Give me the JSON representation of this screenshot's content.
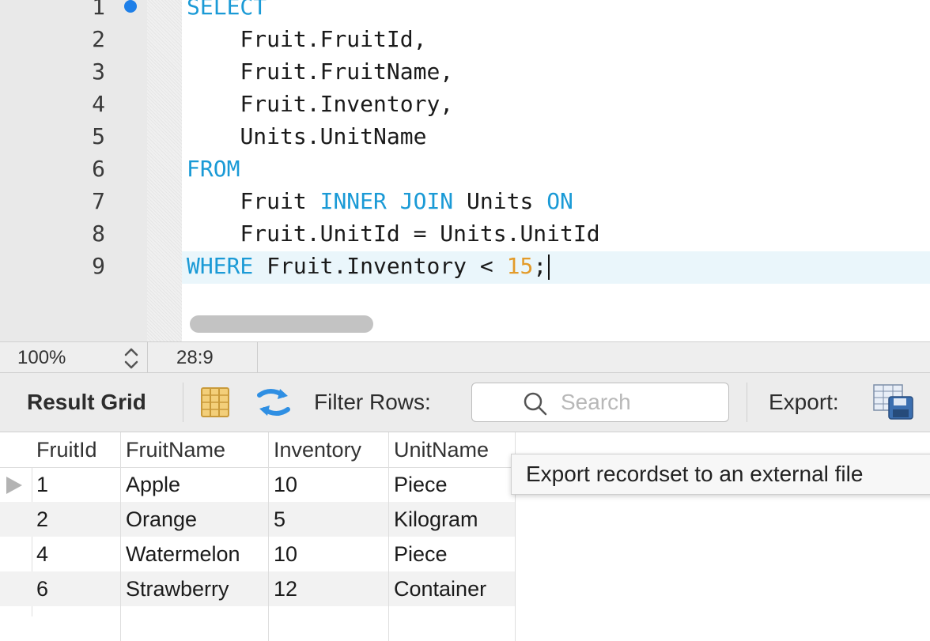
{
  "editor": {
    "line_numbers": [
      "1",
      "2",
      "3",
      "4",
      "5",
      "6",
      "7",
      "8",
      "9"
    ],
    "lines": [
      {
        "kw": "SELECT"
      },
      {
        "indent": "    ",
        "text": "Fruit.FruitId,"
      },
      {
        "indent": "    ",
        "text": "Fruit.FruitName,"
      },
      {
        "indent": "    ",
        "text": "Fruit.Inventory,"
      },
      {
        "indent": "    ",
        "text": "Units.UnitName"
      },
      {
        "kw": "FROM"
      },
      {
        "indent": "    ",
        "t1": "Fruit ",
        "kw1": "INNER JOIN",
        "t2": " Units ",
        "kw2": "ON"
      },
      {
        "indent": "    ",
        "text": "Fruit.UnitId = Units.UnitId"
      },
      {
        "kw": "WHERE",
        "t1": " Fruit.Inventory < ",
        "num": "15",
        "t2": ";"
      }
    ]
  },
  "status": {
    "zoom": "100%",
    "cursor_position": "28:9"
  },
  "toolbar": {
    "result_grid_label": "Result Grid",
    "filter_label": "Filter Rows:",
    "search_placeholder": "Search",
    "export_label": "Export:",
    "export_tooltip": "Export recordset to an external file"
  },
  "grid": {
    "columns": [
      "FruitId",
      "FruitName",
      "Inventory",
      "UnitName"
    ],
    "rows": [
      [
        "1",
        "Apple",
        "10",
        "Piece"
      ],
      [
        "2",
        "Orange",
        "5",
        "Kilogram"
      ],
      [
        "4",
        "Watermelon",
        "10",
        "Piece"
      ],
      [
        "6",
        "Strawberry",
        "12",
        "Container"
      ]
    ]
  },
  "colors": {
    "keyword": "#1a9ad6",
    "number": "#e39b2a",
    "breakpoint": "#1e7fe8"
  },
  "icons": {
    "grid_layout": "grid-layout-icon",
    "refresh": "refresh-icon",
    "search": "search-icon",
    "export": "export-icon",
    "stepper": "zoom-stepper-icon",
    "row_pointer": "current-row-pointer-icon"
  }
}
